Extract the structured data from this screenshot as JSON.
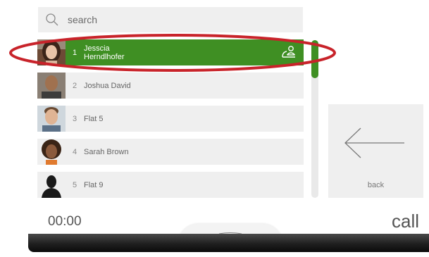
{
  "search": {
    "placeholder": "search",
    "icon": "search-icon"
  },
  "contacts": [
    {
      "number": "1",
      "name_line1": "Jesscia",
      "name_line2": "Herndlhofer",
      "selected": true,
      "avatar": "woman-photo"
    },
    {
      "number": "2",
      "name_line1": "Joshua David",
      "name_line2": "",
      "selected": false,
      "avatar": "bald-man-photo"
    },
    {
      "number": "3",
      "name_line1": "Flat 5",
      "name_line2": "",
      "selected": false,
      "avatar": "smiling-man-photo"
    },
    {
      "number": "4",
      "name_line1": "Sarah Brown",
      "name_line2": "",
      "selected": false,
      "avatar": "curly-hair-woman-photo"
    },
    {
      "number": "5",
      "name_line1": "Flat 9",
      "name_line2": "",
      "selected": false,
      "avatar": "silhouette-icon"
    }
  ],
  "back_button": {
    "label": "back",
    "icon": "arrow-left-icon"
  },
  "status": {
    "timer": "00:00",
    "call_label": "call"
  },
  "colors": {
    "accent": "#3f8f23",
    "row_bg": "#efefef",
    "highlight_ring": "#c8232a"
  },
  "scroll_position": 0.0
}
